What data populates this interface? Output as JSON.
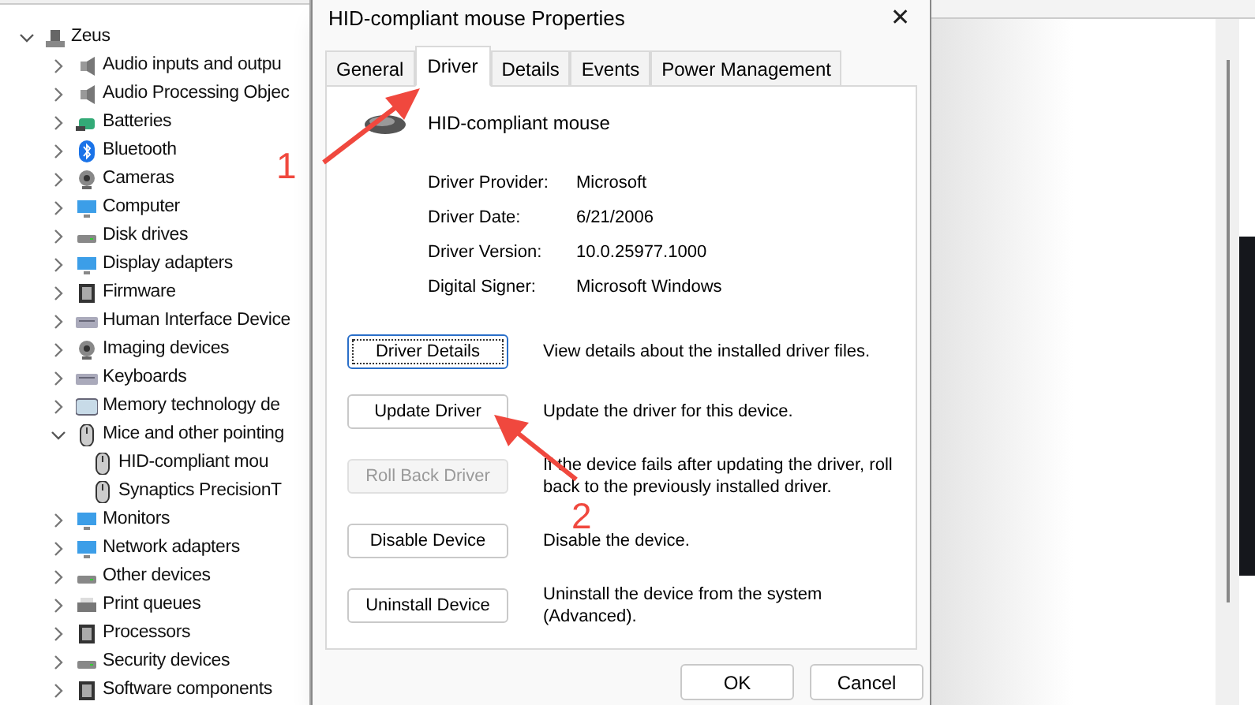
{
  "device_tree": {
    "label": "Zeus",
    "kind": "computer",
    "expanded": true,
    "children": [
      {
        "label": "Audio inputs and outpu",
        "kind": "speaker",
        "expanded": false
      },
      {
        "label": "Audio Processing Objec",
        "kind": "speaker",
        "expanded": false
      },
      {
        "label": "Batteries",
        "kind": "battery",
        "expanded": false
      },
      {
        "label": "Bluetooth",
        "kind": "bluetooth",
        "expanded": false
      },
      {
        "label": "Cameras",
        "kind": "camera",
        "expanded": false
      },
      {
        "label": "Computer",
        "kind": "monitor",
        "expanded": false
      },
      {
        "label": "Disk drives",
        "kind": "disk",
        "expanded": false
      },
      {
        "label": "Display adapters",
        "kind": "monitor",
        "expanded": false
      },
      {
        "label": "Firmware",
        "kind": "chip",
        "expanded": false
      },
      {
        "label": "Human Interface Device",
        "kind": "keyboard",
        "expanded": false
      },
      {
        "label": "Imaging devices",
        "kind": "camera",
        "expanded": false
      },
      {
        "label": "Keyboards",
        "kind": "keyboard",
        "expanded": false
      },
      {
        "label": "Memory technology de",
        "kind": "card",
        "expanded": false
      },
      {
        "label": "Mice and other pointing",
        "kind": "mouse",
        "expanded": true,
        "children": [
          {
            "label": "HID-compliant mou",
            "kind": "mouse"
          },
          {
            "label": "Synaptics PrecisionT",
            "kind": "mouse"
          }
        ]
      },
      {
        "label": "Monitors",
        "kind": "monitor",
        "expanded": false
      },
      {
        "label": "Network adapters",
        "kind": "monitor",
        "expanded": false
      },
      {
        "label": "Other devices",
        "kind": "disk",
        "expanded": false
      },
      {
        "label": "Print queues",
        "kind": "printer",
        "expanded": false
      },
      {
        "label": "Processors",
        "kind": "chip",
        "expanded": false
      },
      {
        "label": "Security devices",
        "kind": "disk",
        "expanded": false
      },
      {
        "label": "Software components",
        "kind": "chip",
        "expanded": false
      }
    ]
  },
  "dialog": {
    "title": "HID-compliant mouse Properties",
    "close": "✕",
    "tabs": [
      {
        "label": "General",
        "selected": false
      },
      {
        "label": "Driver",
        "selected": true
      },
      {
        "label": "Details",
        "selected": false
      },
      {
        "label": "Events",
        "selected": false
      },
      {
        "label": "Power Management",
        "selected": false
      }
    ],
    "device_name": "HID-compliant mouse",
    "properties": [
      {
        "label": "Driver Provider:",
        "value": "Microsoft"
      },
      {
        "label": "Driver Date:",
        "value": "6/21/2006"
      },
      {
        "label": "Driver Version:",
        "value": "10.0.25977.1000"
      },
      {
        "label": "Digital Signer:",
        "value": "Microsoft Windows"
      }
    ],
    "actions": [
      {
        "button": "Driver Details",
        "description": "View details about the installed driver files.",
        "disabled": false,
        "focused": true
      },
      {
        "button": "Update Driver",
        "description": "Update the driver for this device.",
        "disabled": false,
        "focused": false
      },
      {
        "button": "Roll Back Driver",
        "description": "If the device fails after updating the driver, roll back to the previously installed driver.",
        "disabled": true,
        "focused": false
      },
      {
        "button": "Disable Device",
        "description": "Disable the device.",
        "disabled": false,
        "focused": false
      },
      {
        "button": "Uninstall Device",
        "description": "Uninstall the device from the system (Advanced).",
        "disabled": false,
        "focused": false
      }
    ],
    "buttons": [
      "OK",
      "Cancel"
    ]
  },
  "annotations": [
    {
      "label": "1"
    },
    {
      "label": "2"
    }
  ]
}
